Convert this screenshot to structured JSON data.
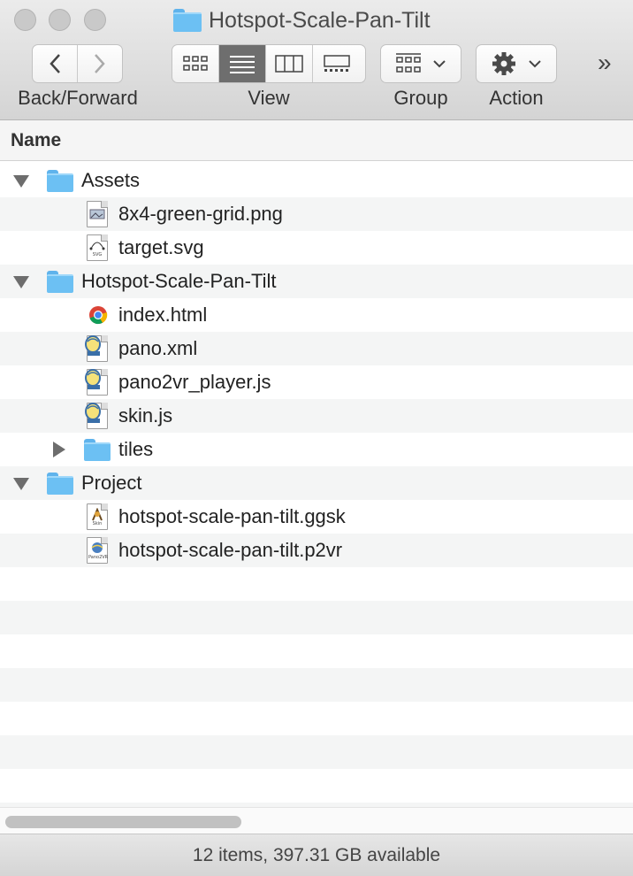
{
  "window": {
    "title": "Hotspot-Scale-Pan-Tilt"
  },
  "toolbar": {
    "back_forward_label": "Back/Forward",
    "view_label": "View",
    "group_label": "Group",
    "action_label": "Action",
    "overflow": "»"
  },
  "columns": {
    "name": "Name"
  },
  "rows": [
    {
      "name": "Assets",
      "icon": "folder-icon",
      "disclosure": "open"
    },
    {
      "name": "8x4-green-grid.png",
      "icon": "png-file-icon"
    },
    {
      "name": "target.svg",
      "icon": "svg-file-icon",
      "tag": "SVG"
    },
    {
      "name": "Hotspot-Scale-Pan-Tilt",
      "icon": "folder-icon",
      "disclosure": "open"
    },
    {
      "name": "index.html",
      "icon": "chrome-html-icon"
    },
    {
      "name": "pano.xml",
      "icon": "pano2vr-text-icon"
    },
    {
      "name": "pano2vr_player.js",
      "icon": "pano2vr-text-icon"
    },
    {
      "name": "skin.js",
      "icon": "pano2vr-text-icon"
    },
    {
      "name": "tiles",
      "icon": "folder-icon",
      "disclosure": "closed"
    },
    {
      "name": "Project",
      "icon": "folder-icon",
      "disclosure": "open"
    },
    {
      "name": "hotspot-scale-pan-tilt.ggsk",
      "icon": "ggsk-file-icon",
      "tag": "Skin"
    },
    {
      "name": "hotspot-scale-pan-tilt.p2vr",
      "icon": "p2vr-file-icon",
      "tag": "Pano2VR"
    }
  ],
  "status": {
    "text": "12 items, 397.31 GB available"
  }
}
